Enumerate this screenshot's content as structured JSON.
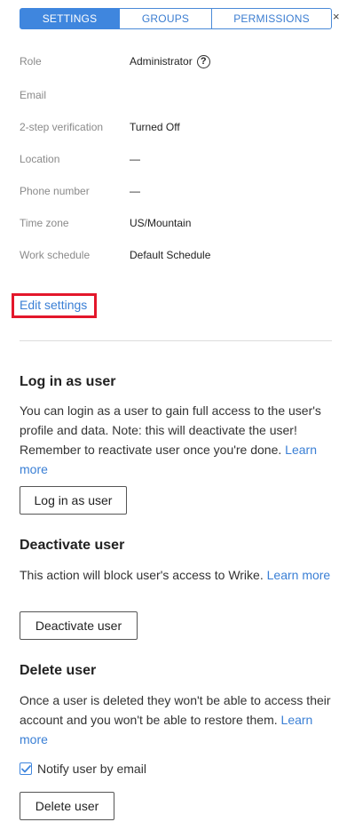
{
  "tabs": {
    "settings": "SETTINGS",
    "groups": "GROUPS",
    "permissions": "PERMISSIONS",
    "active": "SETTINGS"
  },
  "close_glyph": "×",
  "info": {
    "role": {
      "label": "Role",
      "value": "Administrator"
    },
    "email": {
      "label": "Email",
      "value": ""
    },
    "two_step": {
      "label": "2-step verification",
      "value": "Turned Off"
    },
    "location": {
      "label": "Location",
      "value": "—"
    },
    "phone": {
      "label": "Phone number",
      "value": "—"
    },
    "timezone": {
      "label": "Time zone",
      "value": "US/Mountain"
    },
    "work_schedule": {
      "label": "Work schedule",
      "value": "Default Schedule"
    }
  },
  "edit_settings": "Edit settings",
  "login_section": {
    "title": "Log in as user",
    "text": "You can login as a user to gain full access to the user's profile and data. Note: this will deactivate the user! Remember to reactivate user once you're done.",
    "learn_more": "Learn more",
    "button": "Log in as user"
  },
  "deactivate_section": {
    "title": "Deactivate user",
    "text": "This action will block user's access to Wrike.",
    "learn_more": "Learn more",
    "button": "Deactivate user"
  },
  "delete_section": {
    "title": "Delete user",
    "text": "Once a user is deleted they won't be able to access their account and you won't be able to restore them.",
    "learn_more": "Learn more",
    "notify_label": "Notify user by email",
    "notify_checked": true,
    "button": "Delete user"
  },
  "colors": {
    "accent": "#3f86de",
    "link": "#3a7fd5",
    "highlight": "#e3172b"
  }
}
